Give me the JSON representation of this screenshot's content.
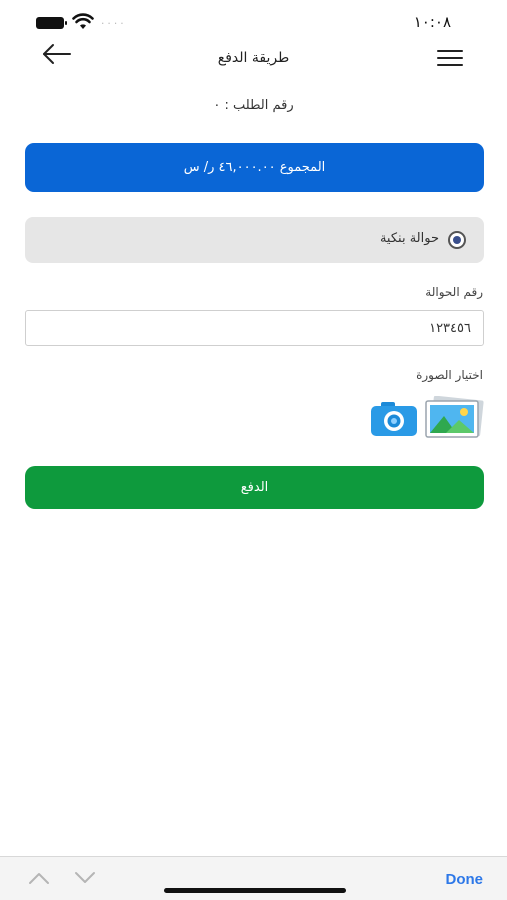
{
  "status_bar": {
    "time": "١٠:٠٨",
    "signal_dots": "....",
    "icons": [
      "battery-icon",
      "wifi-icon",
      "signal-icon"
    ]
  },
  "nav": {
    "title": "طريقة الدفع",
    "back_icon": "arrow-left-icon",
    "menu_icon": "hamburger-menu-icon"
  },
  "order": {
    "number_label": "رقم الطلب : ٠"
  },
  "total": {
    "text": "المجموع ٤٦,٠٠٠.٠٠ ر/ س"
  },
  "payment_method": {
    "label": "حوالة بنكية",
    "selected": true
  },
  "transfer": {
    "label": "رقم الحوالة",
    "value": "١٢٣٤٥٦"
  },
  "image_picker": {
    "label": "اختيار الصورة",
    "icons": [
      "camera-icon",
      "gallery-icon"
    ]
  },
  "pay_button": {
    "label": "الدفع"
  },
  "keyboard_toolbar": {
    "done_label": "Done"
  },
  "colors": {
    "total_banner": "#0a66d6",
    "pay_button": "#0e9a3d",
    "done": "#2d78e8",
    "method_bg": "#e6e6e6"
  }
}
